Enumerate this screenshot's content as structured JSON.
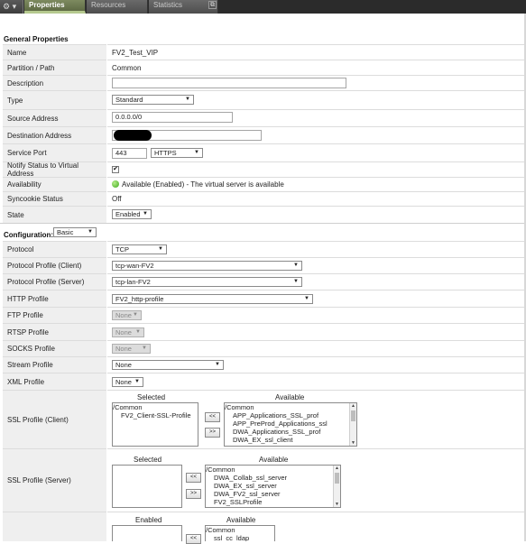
{
  "tabs": {
    "gear": "⚙ ▾",
    "properties": "Properties",
    "resources": "Resources",
    "statistics": "Statistics",
    "icon": "⧉"
  },
  "general": {
    "title": "General Properties",
    "rows": {
      "name": {
        "label": "Name",
        "value": "FV2_Test_VIP"
      },
      "partition": {
        "label": "Partition / Path",
        "value": "Common"
      },
      "description": {
        "label": "Description",
        "value": ""
      },
      "type": {
        "label": "Type",
        "value": "Standard"
      },
      "source": {
        "label": "Source Address",
        "value": "0.0.0.0/0"
      },
      "destination": {
        "label": "Destination Address",
        "value": ""
      },
      "port": {
        "label": "Service Port",
        "value": "443",
        "service": "HTTPS"
      },
      "notify": {
        "label": "Notify Status to Virtual Address",
        "checked": "✔"
      },
      "availability": {
        "label": "Availability",
        "value": "Available (Enabled) - The virtual server is available",
        "status_color": "#3fa91e"
      },
      "syncookie": {
        "label": "Syncookie Status",
        "value": "Off"
      },
      "state": {
        "label": "State",
        "value": "Enabled"
      }
    }
  },
  "configuration": {
    "title": "Configuration:",
    "mode": "Basic",
    "rows": {
      "protocol": {
        "label": "Protocol",
        "value": "TCP"
      },
      "profile_client": {
        "label": "Protocol Profile (Client)",
        "value": "tcp-wan-FV2"
      },
      "profile_server": {
        "label": "Protocol Profile (Server)",
        "value": "tcp-lan-FV2"
      },
      "http": {
        "label": "HTTP Profile",
        "value": "FV2_http-profile"
      },
      "ftp": {
        "label": "FTP Profile",
        "value": "None"
      },
      "rtsp": {
        "label": "RTSP Profile",
        "value": "None"
      },
      "socks": {
        "label": "SOCKS Profile",
        "value": "None"
      },
      "stream": {
        "label": "Stream Profile",
        "value": "None"
      },
      "xml": {
        "label": "XML Profile",
        "value": "None"
      },
      "ssl_client": {
        "label": "SSL Profile (Client)",
        "selected_header": "Selected",
        "available_header": "Available",
        "selected": [
          "/Common",
          "FV2_Client-SSL-Profile"
        ],
        "available": [
          "/Common",
          "APP_Applications_SSL_prof",
          "APP_PreProd_Applications_ssl",
          "DWA_Applications_SSL_prof",
          "DWA_EX_ssl_client"
        ]
      },
      "ssl_server": {
        "label": "SSL Profile (Server)",
        "selected_header": "Selected",
        "available_header": "Available",
        "selected": [],
        "available": [
          "/Common",
          "DWA_Collab_ssl_server",
          "DWA_EX_ssl_server",
          "DWA_FV2_ssl_server",
          "FV2_SSLProfile"
        ]
      },
      "next": {
        "enabled_header": "Enabled",
        "available_header": "Available",
        "available": [
          "/Common",
          "ssl_cc_ldap"
        ]
      }
    },
    "buttons": {
      "add": "<<",
      "remove": ">>"
    }
  }
}
